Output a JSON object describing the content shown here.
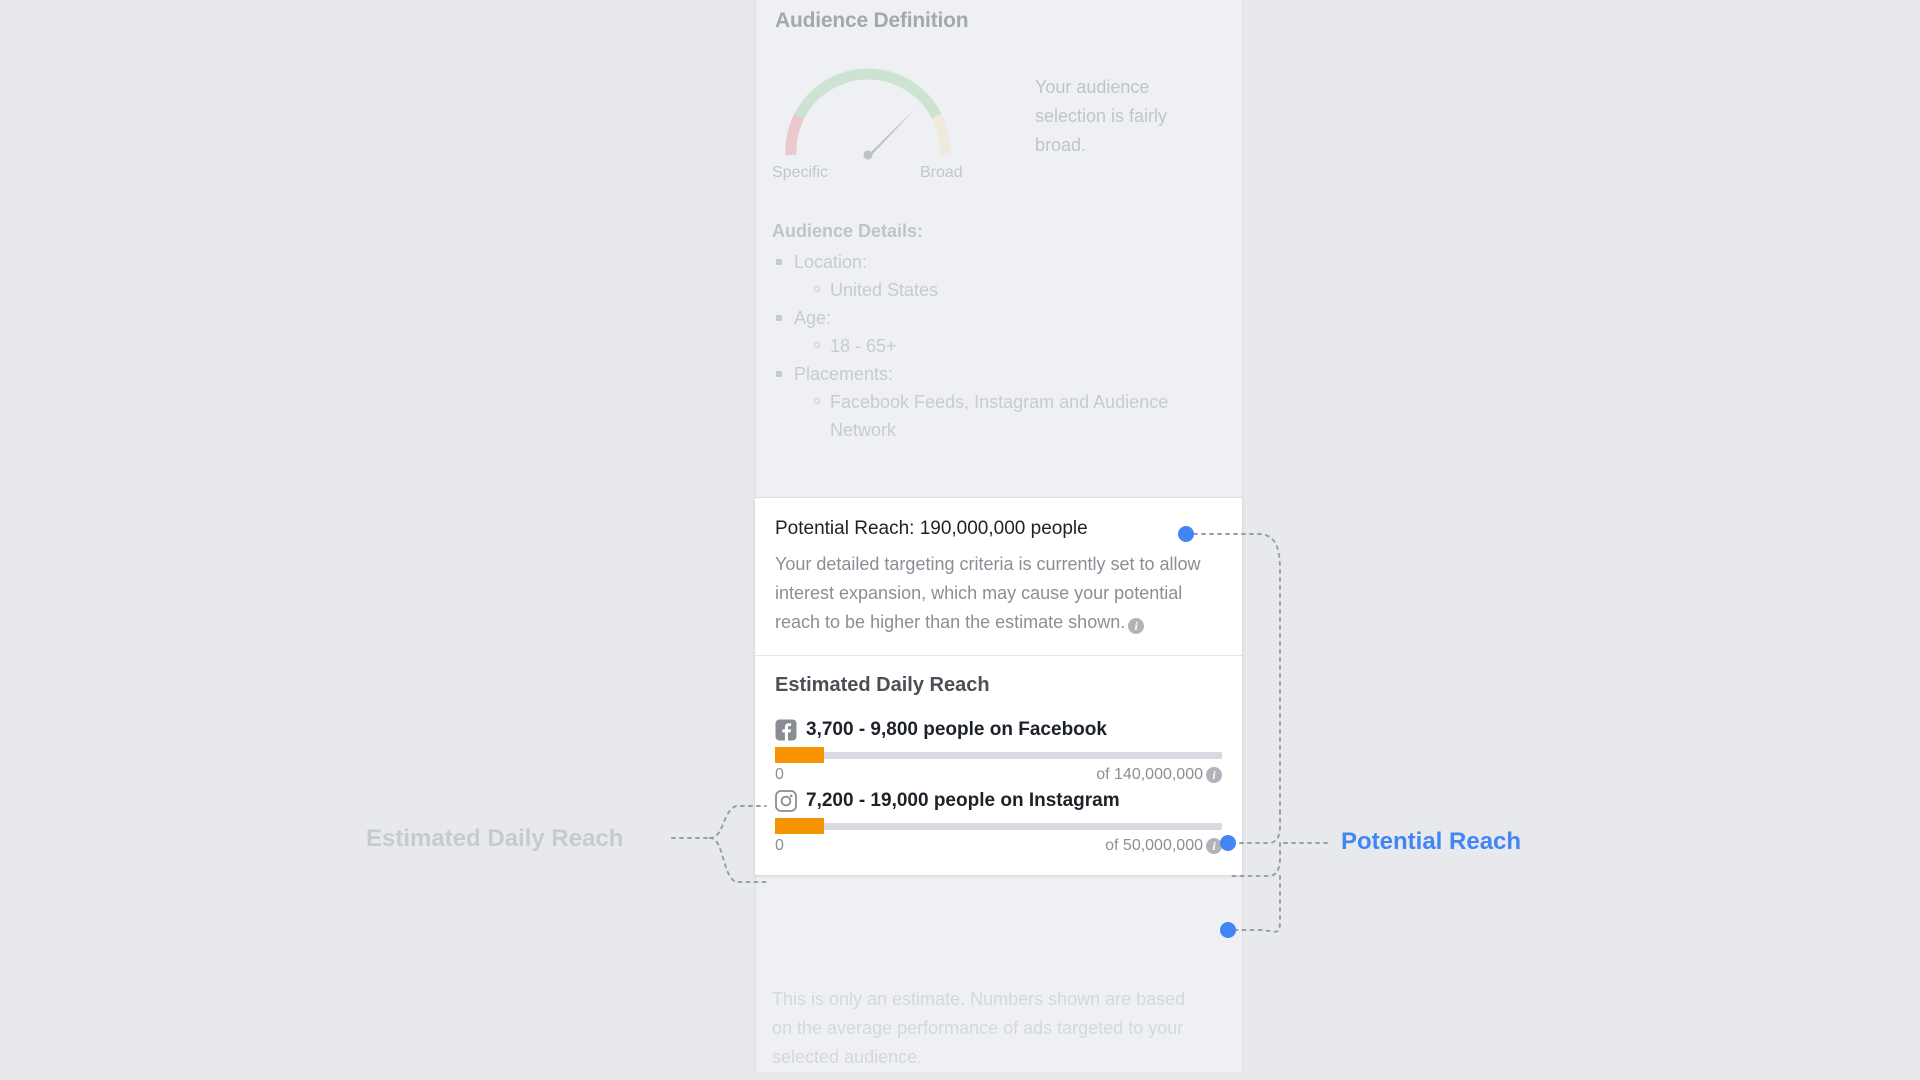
{
  "panel": {
    "title": "Audience Definition",
    "gauge": {
      "left_label": "Specific",
      "right_label": "Broad",
      "note": "Your audience selection is fairly broad.",
      "needle_angle_deg": 48,
      "colors": {
        "low": "#e49aa0",
        "mid": "#a3d5a9",
        "high": "#f2e3c4",
        "needle": "#86898e"
      }
    },
    "details": {
      "title": "Audience Details:",
      "items": [
        {
          "label": "Location:",
          "value": "United States"
        },
        {
          "label": "Age:",
          "value": "18 - 65+"
        },
        {
          "label": "Placements:",
          "value": "Facebook Feeds, Instagram and Audience Network"
        }
      ]
    },
    "footnote": "This is only an estimate. Numbers shown are based on the average performance of ads targeted to your selected audience."
  },
  "reach_card": {
    "potential": {
      "title": "Potential Reach: 190,000,000 people",
      "description": "Your detailed targeting criteria is currently set to allow interest expansion, which may cause your potential reach to be higher than the estimate shown.",
      "info_icon": "info-icon",
      "info_glyph": "i"
    },
    "daily": {
      "title": "Estimated Daily Reach",
      "rows": [
        {
          "platform": "Facebook",
          "platform_icon": "facebook-icon",
          "label": "3,700 - 9,800 people on Facebook",
          "min_label": "0",
          "total_label": "of 140,000,000",
          "fill_percent": 11
        },
        {
          "platform": "Instagram",
          "platform_icon": "instagram-icon",
          "label": "7,200 - 19,000 people on Instagram",
          "min_label": "0",
          "total_label": "of 50,000,000",
          "fill_percent": 11
        }
      ]
    }
  },
  "annotations": {
    "left_label": "Estimated Daily Reach",
    "right_label": "Potential Reach",
    "left_color": "#c7cbd1",
    "right_color": "#4285f4",
    "dot_color": "#4285f4",
    "line_color": "#9aa0a6"
  }
}
